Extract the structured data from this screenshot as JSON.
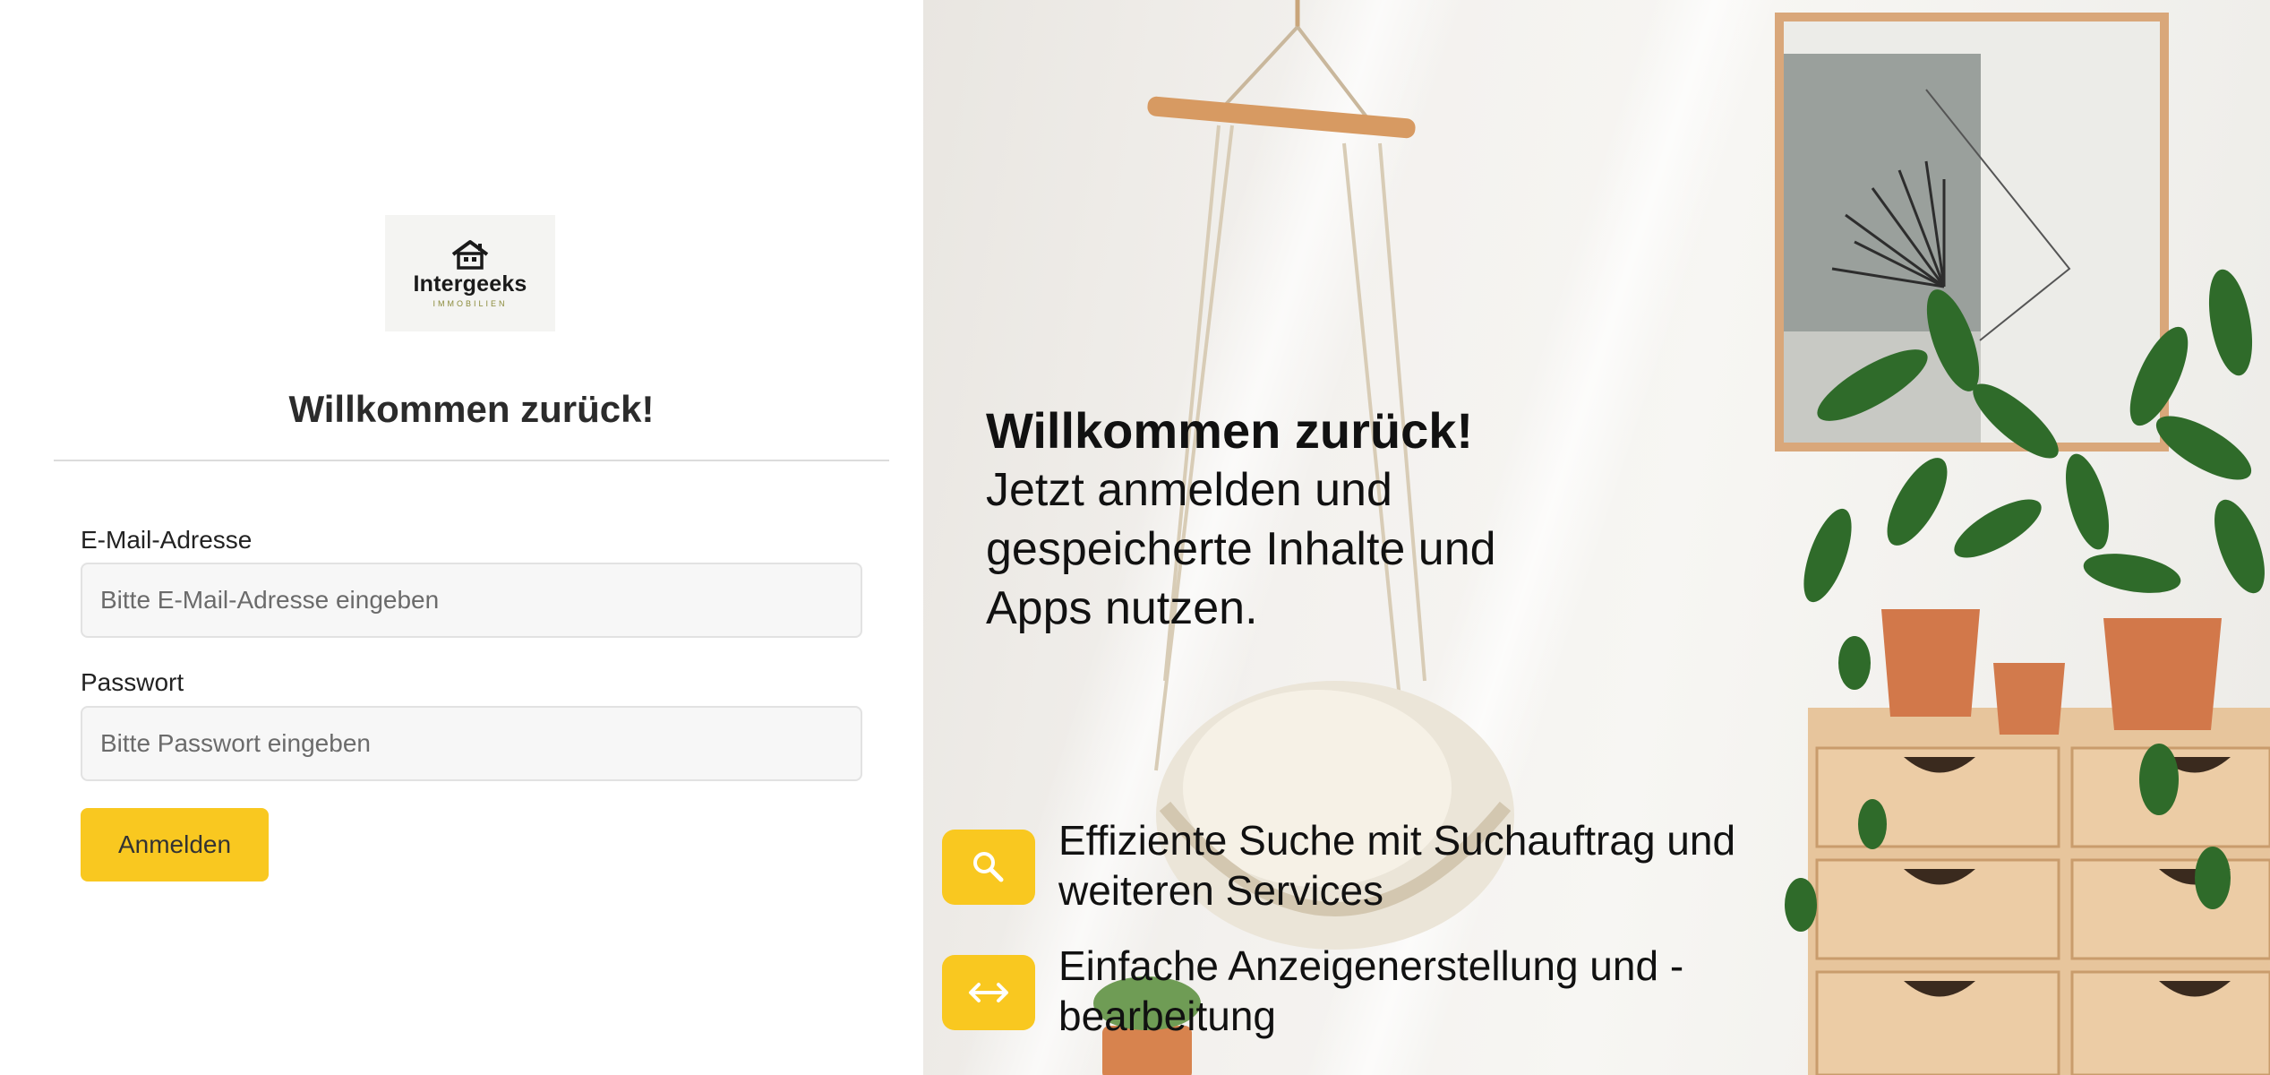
{
  "logo": {
    "name": "Intergeeks",
    "tagline": "IMMOBILIEN"
  },
  "login": {
    "title": "Willkommen zurück!",
    "email_label": "E-Mail-Adresse",
    "email_placeholder": "Bitte E-Mail-Adresse eingeben",
    "password_label": "Passwort",
    "password_placeholder": "Bitte Passwort eingeben",
    "submit_label": "Anmelden"
  },
  "hero": {
    "title": "Willkommen zurück!",
    "subtitle_lines": [
      "Jetzt anmelden und",
      "gespeicherte Inhalte und",
      "Apps nutzen."
    ],
    "features": [
      {
        "icon": "search-icon",
        "lines": [
          "Effiziente Suche mit Suchauftrag und",
          "weiteren Services"
        ]
      },
      {
        "icon": "arrows-horizontal-icon",
        "lines": [
          "Einfache Anzeigenerstellung und -",
          "bearbeitung"
        ]
      }
    ]
  },
  "colors": {
    "accent": "#f9c820",
    "text": "#2b2b2b"
  }
}
